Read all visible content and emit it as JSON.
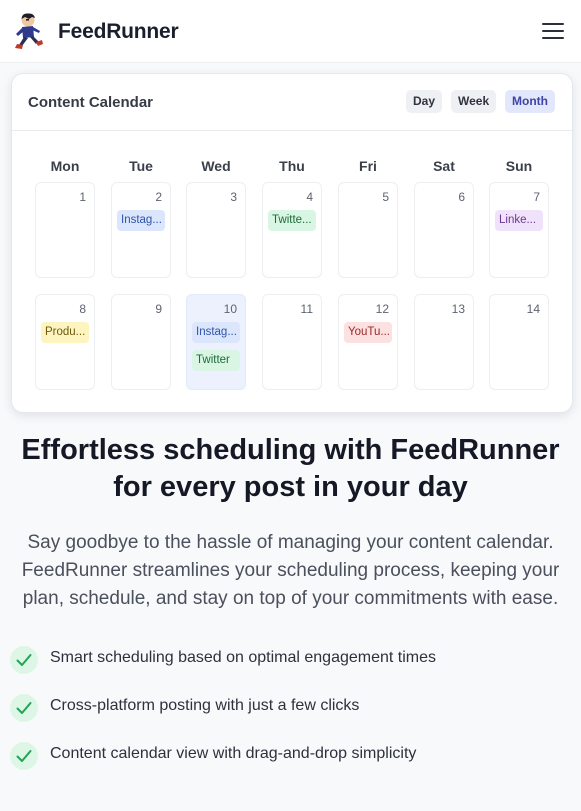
{
  "header": {
    "brand": "FeedRunner",
    "logo_icon": "running-mascot-icon",
    "menu_icon": "hamburger-menu-icon"
  },
  "calendar": {
    "title": "Content Calendar",
    "views": [
      {
        "label": "Day",
        "active": false
      },
      {
        "label": "Week",
        "active": false
      },
      {
        "label": "Month",
        "active": true
      }
    ],
    "days": [
      "Mon",
      "Tue",
      "Wed",
      "Thu",
      "Fri",
      "Sat",
      "Sun"
    ],
    "weeks": [
      [
        {
          "date": "1",
          "events": []
        },
        {
          "date": "2",
          "events": [
            {
              "label": "Instag...",
              "kind": "instagram"
            }
          ]
        },
        {
          "date": "3",
          "events": []
        },
        {
          "date": "4",
          "events": [
            {
              "label": "Twitte...",
              "kind": "twitter"
            }
          ]
        },
        {
          "date": "5",
          "events": []
        },
        {
          "date": "6",
          "events": []
        },
        {
          "date": "7",
          "events": [
            {
              "label": "Linke...",
              "kind": "linkedin"
            }
          ]
        }
      ],
      [
        {
          "date": "8",
          "events": [
            {
              "label": "Produ...",
              "kind": "product"
            }
          ]
        },
        {
          "date": "9",
          "events": []
        },
        {
          "date": "10",
          "highlighted": true,
          "events": [
            {
              "label": "Instag...",
              "kind": "instagram"
            },
            {
              "label": "Twitter",
              "kind": "twitter"
            }
          ]
        },
        {
          "date": "11",
          "events": []
        },
        {
          "date": "12",
          "events": [
            {
              "label": "YouTu...",
              "kind": "youtube"
            }
          ]
        },
        {
          "date": "13",
          "events": []
        },
        {
          "date": "14",
          "events": []
        }
      ]
    ],
    "event_colors": {
      "instagram": {
        "bg": "#dbe6fd",
        "fg": "#2e55a8"
      },
      "twitter": {
        "bg": "#d9f5e3",
        "fg": "#1f6b3b"
      },
      "linkedin": {
        "bg": "#f1e2fb",
        "fg": "#6b3794"
      },
      "product": {
        "bg": "#fdf4bf",
        "fg": "#6e5a10"
      },
      "youtube": {
        "bg": "#fde0e0",
        "fg": "#9a2a2a"
      }
    }
  },
  "hero": {
    "headline_line1": "Effortless scheduling with FeedRunner",
    "headline_line2": "for every post in your day",
    "sub_line1": "Say goodbye to the hassle of managing your content calendar.",
    "sub_line2": "FeedRunner streamlines your scheduling process, keeping your",
    "sub_line3": "plan, schedule, and stay on top of your commitments with ease."
  },
  "features": [
    {
      "text": "Smart scheduling based on optimal engagement times",
      "icon": "check-icon"
    },
    {
      "text": "Cross-platform posting with just a few clicks",
      "icon": "check-icon"
    },
    {
      "text": "Content calendar view with drag-and-drop simplicity",
      "icon": "check-icon"
    }
  ],
  "colors": {
    "accent": "#3c45a5",
    "check_bg": "#def6e6",
    "check_stroke": "#22a454"
  }
}
